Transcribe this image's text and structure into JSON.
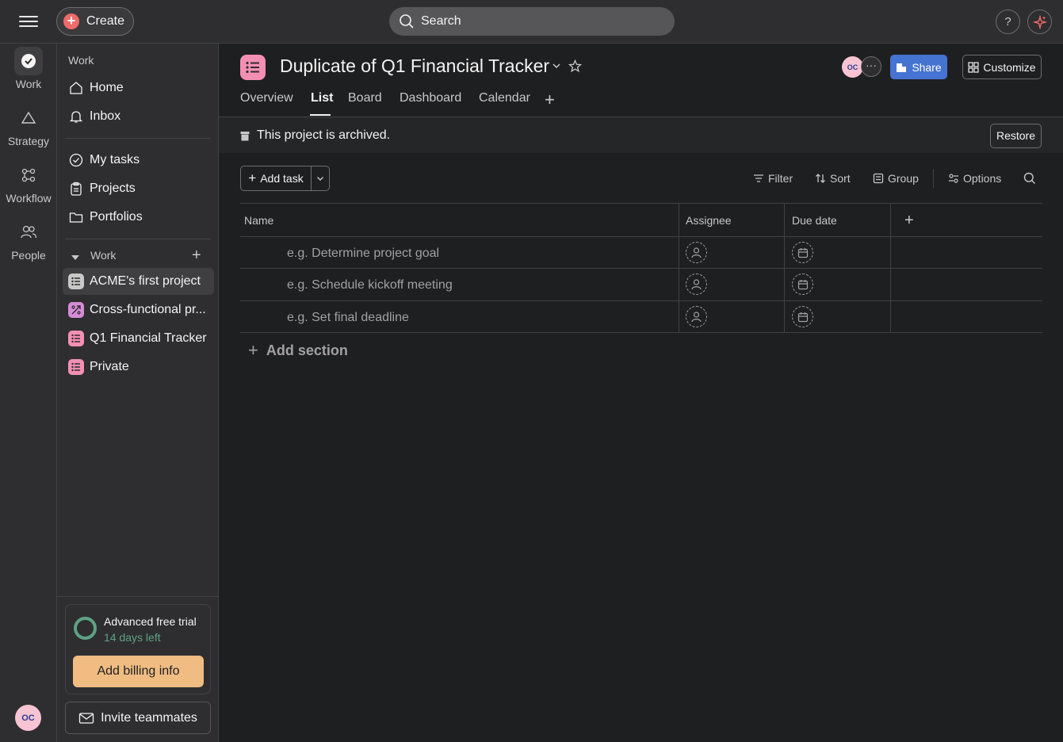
{
  "topbar": {
    "create_label": "Create",
    "search_placeholder": "Search",
    "help_label": "?"
  },
  "rail": {
    "items": [
      {
        "label": "Work",
        "icon": "check-circle-icon"
      },
      {
        "label": "Strategy",
        "icon": "triangle-icon"
      },
      {
        "label": "Workflow",
        "icon": "workflow-icon"
      },
      {
        "label": "People",
        "icon": "people-icon"
      }
    ],
    "avatar_initials": "OC"
  },
  "sidebar": {
    "section_title": "Work",
    "nav": [
      {
        "label": "Home",
        "icon": "home-icon"
      },
      {
        "label": "Inbox",
        "icon": "bell-icon"
      }
    ],
    "nav2": [
      {
        "label": "My tasks",
        "icon": "check-circle-icon"
      },
      {
        "label": "Projects",
        "icon": "clipboard-icon"
      },
      {
        "label": "Portfolios",
        "icon": "folder-icon"
      }
    ],
    "work_heading": "Work",
    "projects": [
      {
        "label": "ACME's first project",
        "color": "#c8c8c8"
      },
      {
        "label": "Cross-functional pr...",
        "color": "#d68bd8"
      },
      {
        "label": "Q1 Financial Tracker",
        "color": "#f48fb4"
      },
      {
        "label": "Private",
        "color": "#f48fb4"
      }
    ],
    "trial": {
      "title": "Advanced free trial",
      "days_left": "14 days left",
      "billing_button": "Add billing info"
    },
    "invite_label": "Invite teammates"
  },
  "header": {
    "project_title": "Duplicate of Q1 Financial Tracker",
    "avatar_initials": "OC",
    "more_label": "···",
    "share_label": "Share",
    "customize_label": "Customize",
    "tabs": [
      "Overview",
      "List",
      "Board",
      "Dashboard",
      "Calendar"
    ],
    "active_tab": "List",
    "add_tab_label": "+"
  },
  "banner": {
    "text": "This project is archived.",
    "restore_label": "Restore"
  },
  "toolbar": {
    "add_task_label": "Add task",
    "filter_label": "Filter",
    "sort_label": "Sort",
    "group_label": "Group",
    "options_label": "Options"
  },
  "table": {
    "columns": [
      "Name",
      "Assignee",
      "Due date"
    ],
    "add_column_label": "+",
    "rows": [
      {
        "name": "e.g. Determine project goal"
      },
      {
        "name": "e.g. Schedule kickoff meeting"
      },
      {
        "name": "e.g. Set final deadline"
      }
    ],
    "add_section_label": "Add section"
  },
  "colors": {
    "background": "#1e1f21",
    "surface": "#2e2e30",
    "accent_blue": "#4573d2",
    "create_red": "#f06a6a",
    "trial_green": "#5da283",
    "billing_orange": "#f0bc82",
    "project_pink": "#f48fb4"
  }
}
